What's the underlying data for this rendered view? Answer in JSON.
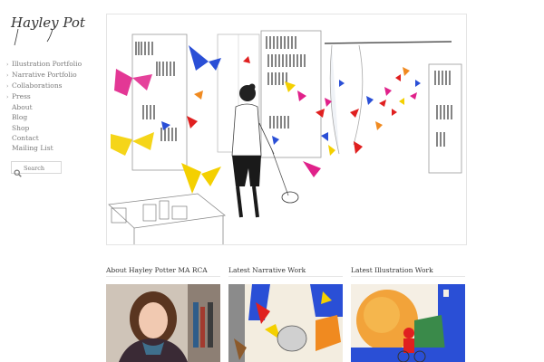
{
  "site": {
    "logo_text": "Hayley Potter"
  },
  "nav": [
    {
      "label": "Illustration Portfolio",
      "arrow": true
    },
    {
      "label": "Narrative Portfolio",
      "arrow": true
    },
    {
      "label": "Collaborations",
      "arrow": true
    },
    {
      "label": "Press",
      "arrow": true
    },
    {
      "label": "About",
      "arrow": false
    },
    {
      "label": "Blog",
      "arrow": false
    },
    {
      "label": "Shop",
      "arrow": false
    },
    {
      "label": "Contact",
      "arrow": false
    },
    {
      "label": "Mailing List",
      "arrow": false
    }
  ],
  "search": {
    "placeholder": "Search",
    "icon": "search-icon"
  },
  "hero": {
    "image": "illustration of a woman in a library with colourful paper butterflies"
  },
  "columns": [
    {
      "title": "About Hayley Potter MA RCA",
      "image": "portrait photo"
    },
    {
      "title": "Latest Narrative Work",
      "image": "colourful narrative illustration"
    },
    {
      "title": "Latest Illustration Work",
      "image": "colourful illustration with orange sun"
    }
  ],
  "colors": {
    "butterfly_pink": "#e0218a",
    "butterfly_red": "#e02020",
    "butterfly_yellow": "#f4d000",
    "butterfly_blue": "#2a4fd6",
    "butterfly_orange": "#f08a20"
  }
}
